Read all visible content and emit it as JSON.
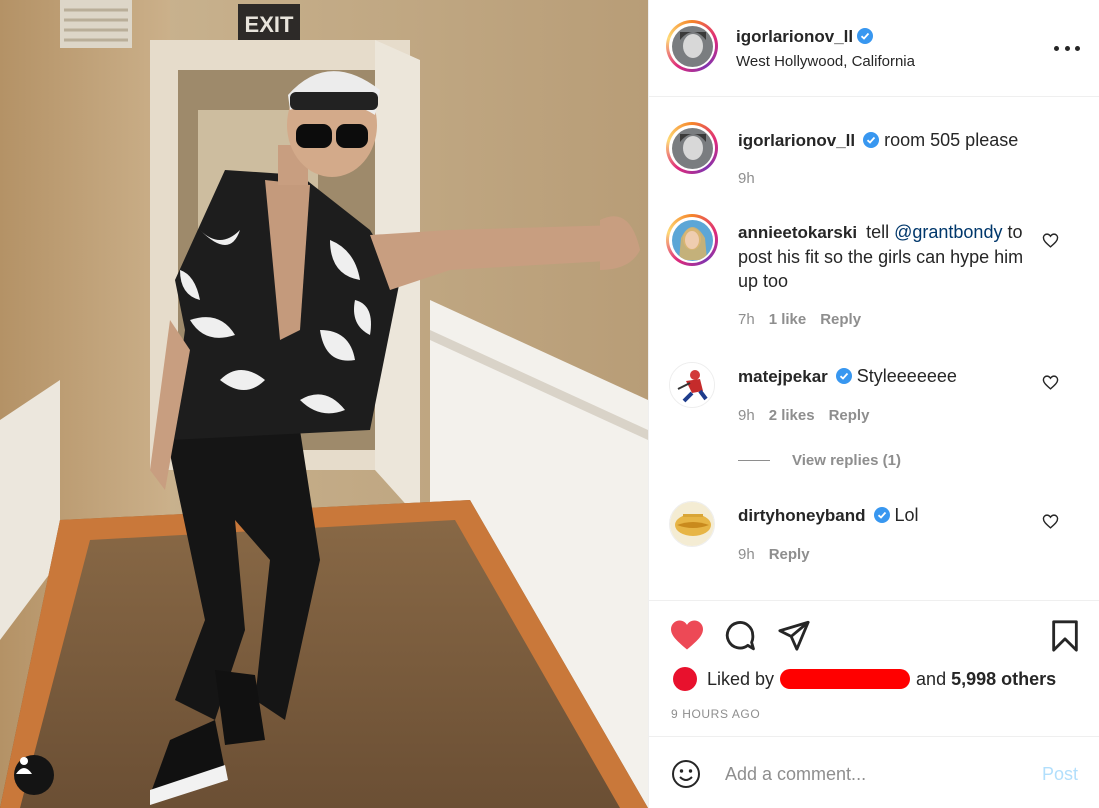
{
  "post": {
    "author": "igorlarionov_ll",
    "location": "West Hollywood, California",
    "caption": "room 505 please",
    "caption_time": "9h",
    "exit_sign": "EXIT"
  },
  "comments": [
    {
      "username": "annieetokarski",
      "text_before": "tell",
      "mention": "@grantbondy",
      "text_after": "to post his fit so the girls can hype him up too",
      "time": "7h",
      "likes": "1 like",
      "reply": "Reply"
    },
    {
      "username": "matejpekar",
      "text": "Styleeeeeee",
      "time": "9h",
      "likes": "2 likes",
      "reply": "Reply",
      "view_replies": "View replies (1)"
    },
    {
      "username": "dirtyhoneyband",
      "text": "Lol",
      "time": "9h",
      "reply": "Reply"
    }
  ],
  "likes": {
    "prefix": "Liked by",
    "conjunction": "and",
    "others": "5,998 others"
  },
  "timestamp": "9 HOURS AGO",
  "composer": {
    "placeholder": "Add a comment...",
    "post_label": "Post"
  },
  "colors": {
    "liked_heart": "#ed4956",
    "verified": "#3897f0",
    "mention": "#00376b",
    "post_disabled": "#b2dffc"
  }
}
